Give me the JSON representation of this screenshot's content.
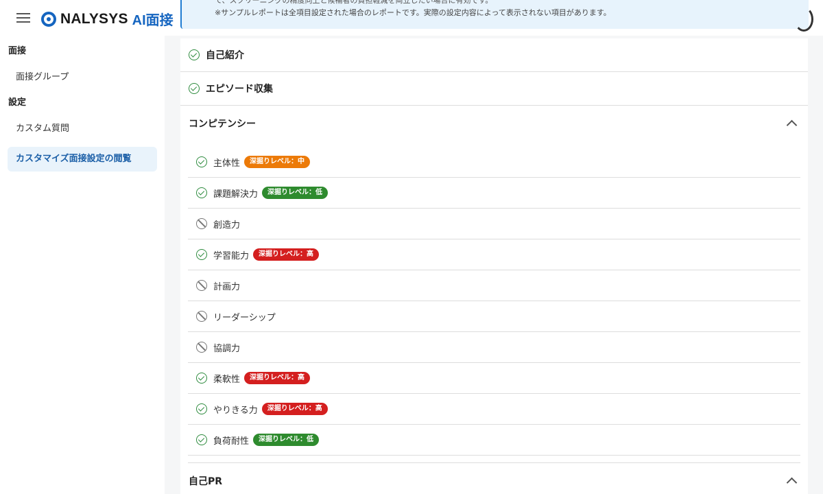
{
  "app": {
    "logo_text": "NALYSYS",
    "logo_sub": "AI面接",
    "menu_icon": "hamburger-icon",
    "accent_color": "#1565c0"
  },
  "notice": {
    "line1": "て、スクリーニングの精度向上と候補者の負担軽減を両立したい場合に有効です。",
    "line2": "※サンプルレポートは全項目設定された場合のレポートです。実際の設定内容によって表示されない項目があります。"
  },
  "sidebar": {
    "section1": "面接",
    "item_group": "面接グループ",
    "section2": "設定",
    "item_custom": "カスタム質問",
    "item_active": "カスタマイズ面接設定の閲覧"
  },
  "main": {
    "rows": [
      {
        "label": "自己紹介",
        "icon": "check-circle-icon"
      },
      {
        "label": "エピソード収集",
        "icon": "check-circle-icon"
      }
    ],
    "competency": {
      "title": "コンピテンシー",
      "items": [
        {
          "label": "主体性",
          "enabled": true,
          "badge": "深掘りレベル：中",
          "badge_color": "#ec7a08"
        },
        {
          "label": "課題解決力",
          "enabled": true,
          "badge": "深掘りレベル：低",
          "badge_color": "#2e8b2e"
        },
        {
          "label": "創造力",
          "enabled": false
        },
        {
          "label": "学習能力",
          "enabled": true,
          "badge": "深掘りレベル：高",
          "badge_color": "#d41f1f"
        },
        {
          "label": "計画力",
          "enabled": false
        },
        {
          "label": "リーダーシップ",
          "enabled": false
        },
        {
          "label": "協調力",
          "enabled": false
        },
        {
          "label": "柔軟性",
          "enabled": true,
          "badge": "深掘りレベル：高",
          "badge_color": "#d41f1f"
        },
        {
          "label": "やりきる力",
          "enabled": true,
          "badge": "深掘りレベル：高",
          "badge_color": "#d41f1f"
        },
        {
          "label": "負荷耐性",
          "enabled": true,
          "badge": "深掘りレベル：低",
          "badge_color": "#2e8b2e"
        }
      ]
    },
    "self_pr": {
      "title": "自己PR"
    }
  }
}
